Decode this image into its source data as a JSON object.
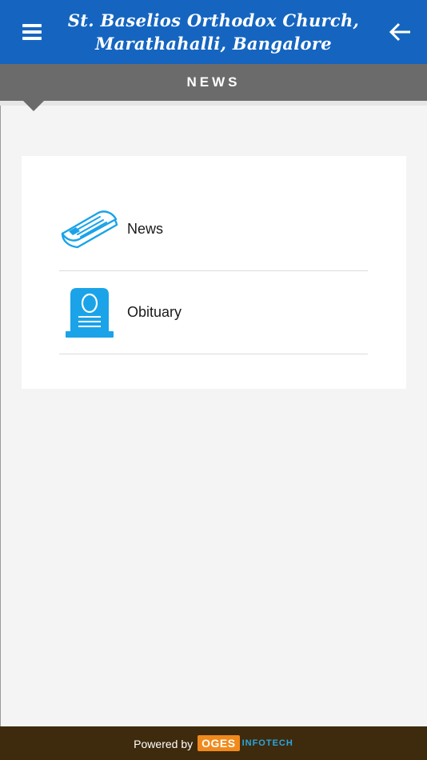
{
  "header": {
    "title_line1": "St. Baselios Orthodox Church,",
    "title_line2": "Marathahalli, Bangalore",
    "menu_icon": "hamburger-menu-icon",
    "back_icon": "arrow-left-icon"
  },
  "section": {
    "title": "NEWS"
  },
  "menu": {
    "items": [
      {
        "label": "News",
        "icon": "newspaper-icon"
      },
      {
        "label": "Obituary",
        "icon": "tombstone-icon"
      }
    ]
  },
  "footer": {
    "powered_by": "Powered by",
    "brand_badge": "OGES",
    "brand_suffix": "INFOTECH"
  },
  "colors": {
    "header_bg": "#1565c0",
    "section_bar_bg": "#6b6b6b",
    "footer_bg": "#3e2a0d",
    "icon_blue": "#1aa3e8",
    "badge_orange": "#f08a1c"
  }
}
